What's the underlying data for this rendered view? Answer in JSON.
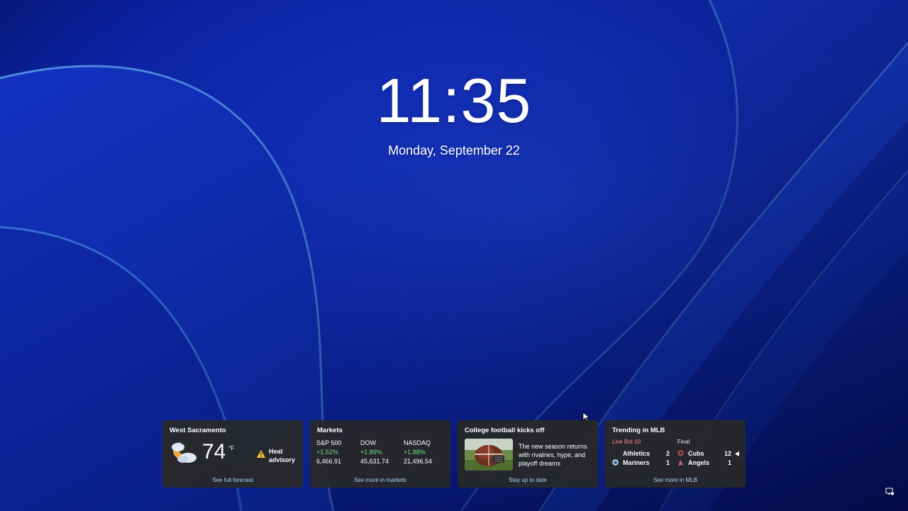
{
  "lock": {
    "time": "11:35",
    "date": "Monday, September 22"
  },
  "weather": {
    "title": "West Sacramento",
    "temperature": "74",
    "unit": "°F",
    "condition_icon": "moon-partly-cloudy-icon",
    "alert_line1": "Heat",
    "alert_line2": "advisory",
    "link": "See full forecast"
  },
  "markets": {
    "title": "Markets",
    "items": [
      {
        "name": "S&P 500",
        "change": "+1.52%",
        "value": "6,466.91"
      },
      {
        "name": "DOW",
        "change": "+1.89%",
        "value": "45,631.74"
      },
      {
        "name": "NASDAQ",
        "change": "+1.88%",
        "value": "21,496.54"
      }
    ],
    "link": "See more in markets",
    "positive_color": "#6ee07a"
  },
  "news": {
    "title": "College football kicks off",
    "summary": "The new season returns with rivalries, hype, and playoff dreams",
    "link": "Stay up to date"
  },
  "mlb": {
    "title": "Trending in MLB",
    "game1": {
      "status": "Live Bot 10",
      "teams": [
        {
          "name": "Athletics",
          "score": "2"
        },
        {
          "name": "Mariners",
          "score": "1"
        }
      ]
    },
    "game2": {
      "status": "Final",
      "teams": [
        {
          "name": "Cubs",
          "score": "12"
        },
        {
          "name": "Angels",
          "score": "1"
        }
      ]
    },
    "link": "See more in MLB",
    "live_color": "#ff8f8f"
  }
}
